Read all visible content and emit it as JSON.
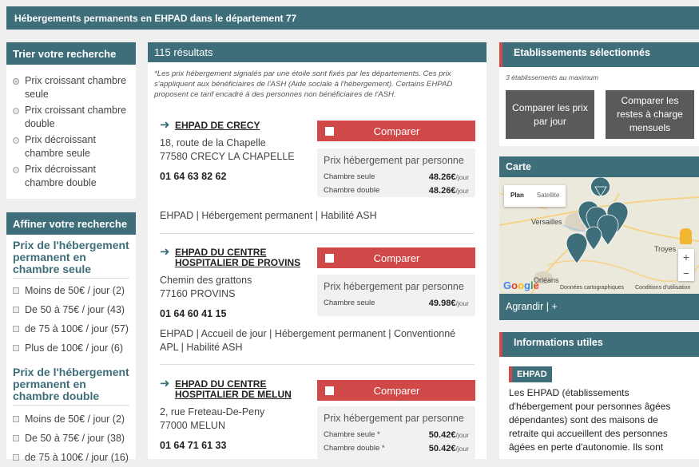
{
  "top_title": "Hébergements permanents en EHPAD dans le département 77",
  "sort": {
    "title": "Trier votre recherche",
    "options": [
      {
        "label": "Prix croissant chambre seule",
        "selected": true
      },
      {
        "label": "Prix croissant chambre double",
        "selected": false
      },
      {
        "label": "Prix décroissant chambre seule",
        "selected": false
      },
      {
        "label": "Prix décroissant chambre double",
        "selected": false
      }
    ]
  },
  "refine": {
    "title": "Affiner votre recherche",
    "group1_title": "Prix de l'hébergement permanent en chambre seule",
    "group1": [
      "Moins de 50€ / jour (2)",
      "De 50 à 75€ / jour (43)",
      "de 75 à 100€ / jour (57)",
      "Plus de 100€ / jour (6)"
    ],
    "group2_title": "Prix de l'hébergement permanent en chambre double",
    "group2": [
      "Moins de 50€ / jour (2)",
      "De 50 à 75€ / jour (38)",
      "de 75 à 100€ / jour (16)"
    ]
  },
  "results": {
    "count_label": "115 résultats",
    "note": "*Les prix hébergement signalés par une étoile sont fixés par les départements. Ces prix s'appliquent aux bénéficiaires de l'ASH (Aide sociale à l'hébergement). Certains EHPAD proposent ce tarif encadré à des personnes non bénéficiaires de l'ASH.",
    "compare_label": "Comparer",
    "price_title": "Prix hébergement par personne",
    "per_day": "/jour",
    "items": [
      {
        "name": "EHPAD DE CRECY",
        "address1": "18, route de la Chapelle",
        "address2": "77580 CRECY LA CHAPELLE",
        "phone": "01 64 63 82 62",
        "prices": [
          {
            "label": "Chambre seule",
            "value": "48.26€"
          },
          {
            "label": "Chambre double",
            "value": "48.26€"
          }
        ],
        "services": "EHPAD | Hébergement permanent | Habilité ASH"
      },
      {
        "name": "EHPAD DU CENTRE HOSPITALIER DE PROVINS",
        "address1": "Chemin des grattons",
        "address2": "77160 PROVINS",
        "phone": "01 64 60 41 15",
        "prices": [
          {
            "label": "Chambre seule",
            "value": "49.98€"
          }
        ],
        "services": "EHPAD | Accueil de jour | Hébergement permanent | Conventionné APL | Habilité ASH"
      },
      {
        "name": "EHPAD DU CENTRE HOSPITALIER DE MELUN",
        "address1": "2, rue Freteau-De-Peny",
        "address2": "77000 MELUN",
        "phone": "01 64 71 61 33",
        "prices": [
          {
            "label": "Chambre seule *",
            "value": "50.42€"
          },
          {
            "label": "Chambre double *",
            "value": "50.42€"
          }
        ],
        "services": ""
      }
    ]
  },
  "selected": {
    "title": "Etablissements sélectionnés",
    "note": "3 établissements au maximum",
    "btn_prices": "Comparer les prix par jour",
    "btn_rest": "Comparer les restes à charge mensuels"
  },
  "map": {
    "title": "Carte",
    "plan": "Plan",
    "satellite": "Satellite",
    "labels": [
      "Versailles",
      "Orléans",
      "Troyes"
    ],
    "google": "Google",
    "data_credit": "Données cartographiques",
    "terms": "Conditions d'utilisation",
    "zoom_in": "+",
    "zoom_out": "−",
    "expand": "Agrandir | +"
  },
  "info": {
    "title": "Informations utiles",
    "tag": "EHPAD",
    "text": "Les EHPAD (établissements d'hébergement pour personnes âgées dépendantes) sont des maisons de retraite qui accueillent des personnes âgées en perte d'autonomie. Ils sont"
  },
  "colors": {
    "teal": "#3d6e79",
    "red": "#d04848",
    "gray_button": "#5a5a5a"
  }
}
